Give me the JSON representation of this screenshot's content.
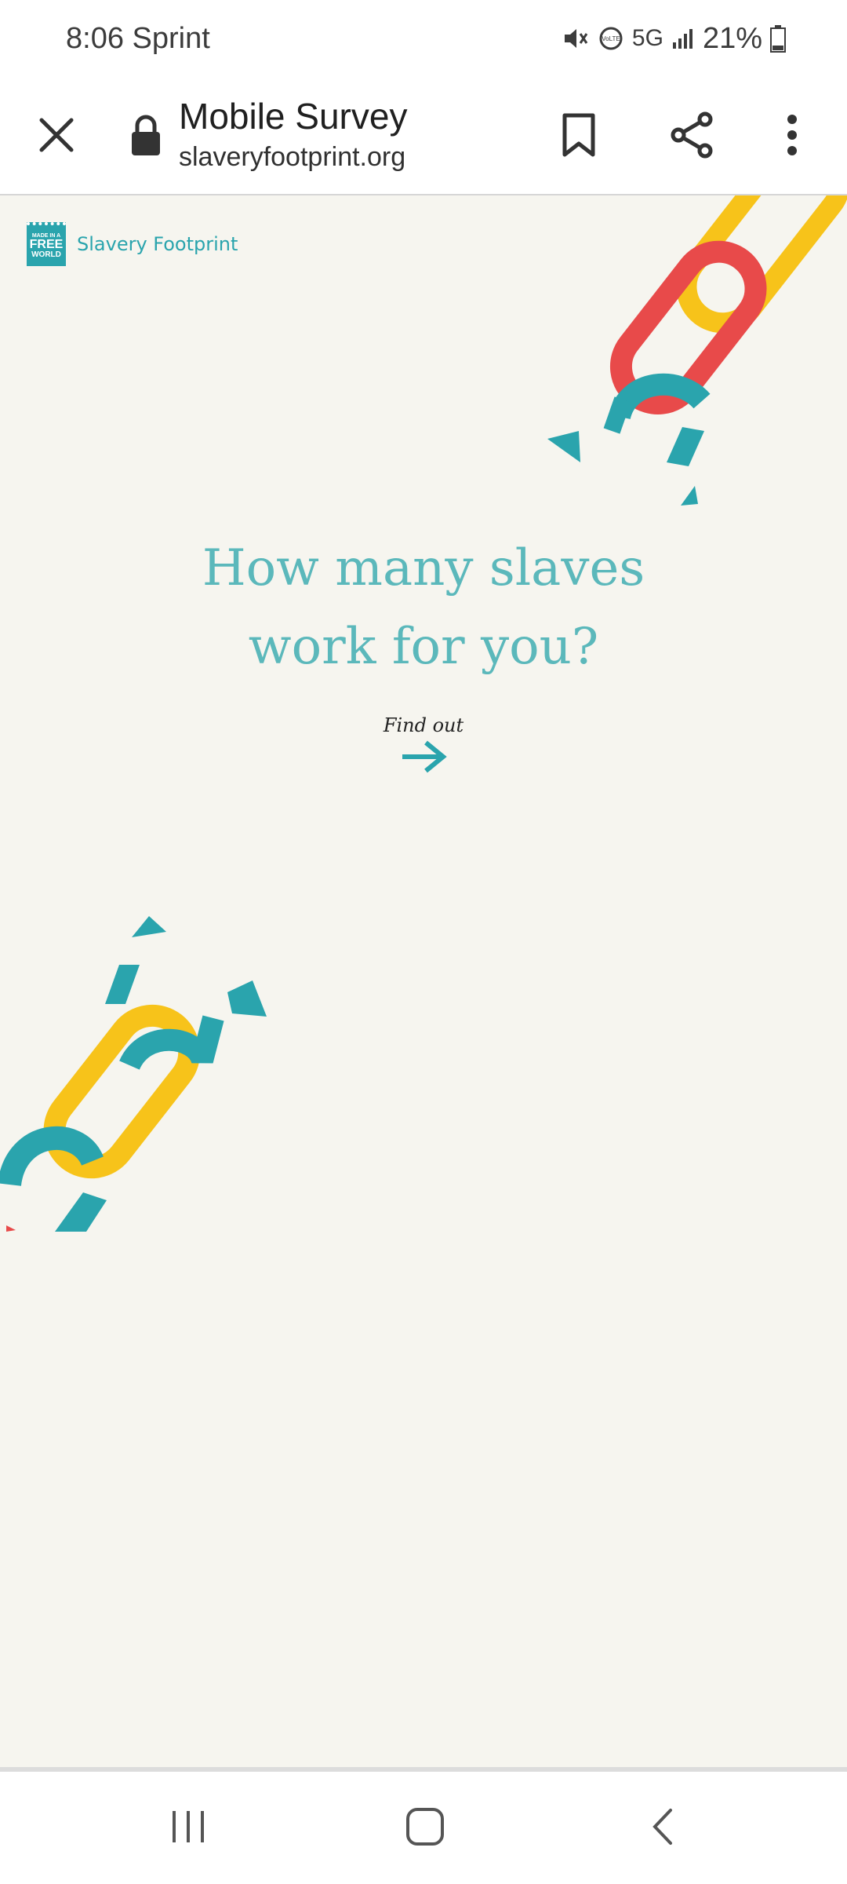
{
  "status_bar": {
    "time_carrier": "8:06 Sprint",
    "network": "5G",
    "battery": "21%"
  },
  "browser": {
    "page_title": "Mobile Survey",
    "url": "slaveryfootprint.org"
  },
  "page": {
    "logo_badge_lines": [
      "MADE IN A",
      "FREE",
      "WORLD"
    ],
    "logo_text": "Slavery Footprint",
    "headline_line1": "How many slaves",
    "headline_line2": "work for you?",
    "cta_label": "Find out"
  },
  "colors": {
    "teal": "#2aa4ad",
    "headline": "#5bb8bb",
    "red": "#e84a4a",
    "yellow": "#f7c31a",
    "background": "#f6f5ef"
  },
  "icons": {
    "close": "close-icon",
    "lock": "lock-icon",
    "bookmark": "bookmark-icon",
    "share": "share-icon",
    "menu": "more-vert-icon",
    "arrow": "arrow-right-icon",
    "nav_recent": "recent-apps-icon",
    "nav_home": "home-icon",
    "nav_back": "back-icon"
  }
}
